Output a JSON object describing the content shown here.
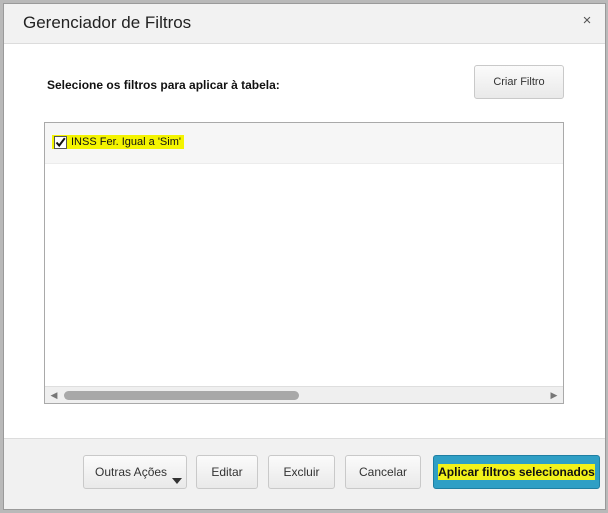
{
  "dialog": {
    "title": "Gerenciador de Filtros",
    "close_glyph": "×"
  },
  "instruction": "Selecione os filtros para aplicar à tabela:",
  "create_filter_label": "Criar Filtro",
  "filters": [
    {
      "label": "INSS Fer. Igual a 'Sim'",
      "checked": true,
      "highlight_color": "#f4f400"
    }
  ],
  "scrollbar": {
    "left_arrow": "◀",
    "right_arrow": "▶"
  },
  "footer": {
    "other_actions_label": "Outras Ações",
    "edit_label": "Editar",
    "delete_label": "Excluir",
    "cancel_label": "Cancelar",
    "apply_label": "Aplicar filtros selecionados"
  },
  "colors": {
    "primary_button": "#2f9fc5",
    "highlight": "#f4f400"
  }
}
